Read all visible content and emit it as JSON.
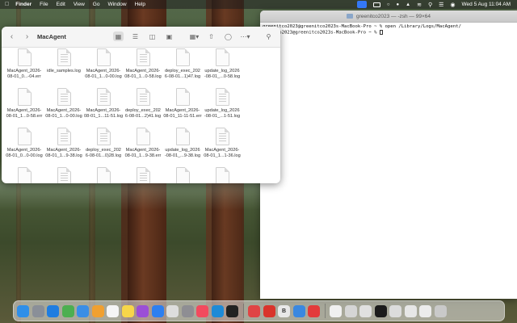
{
  "menubar": {
    "apple_icon": "",
    "app_name": "Finder",
    "menus": [
      "File",
      "Edit",
      "View",
      "Go",
      "Window",
      "Help"
    ],
    "datetime": "Wed 5 Aug  11:04 AM"
  },
  "finder": {
    "folder_title": "MacAgent",
    "back_glyph": "‹",
    "forward_glyph": "›",
    "toolbar_icons": [
      "icon-view-grid-icon",
      "list-view-icon",
      "column-view-icon",
      "gallery-view-icon",
      "group-icon",
      "share-icon",
      "tag-icon",
      "more-icon",
      "search-icon"
    ],
    "files": [
      {
        "label1": "MacAgent_2026-",
        "label2": "08-01_0...-04.err",
        "kind": "plain"
      },
      {
        "label1": "idle_samples.log",
        "label2": "",
        "kind": "log"
      },
      {
        "label1": "MacAgent_2026-",
        "label2": "08-01_1...0-00.log",
        "kind": "plain"
      },
      {
        "label1": "MacAgent_2026-",
        "label2": "08-01_1...0-58.log",
        "kind": "log"
      },
      {
        "label1": "deploy_exec_202",
        "label2": "6-08-01...1)47.log",
        "kind": "plain"
      },
      {
        "label1": "update_log_2026",
        "label2": "-08-01_...0-58.log",
        "kind": "plain"
      },
      {
        "label1": "MacAgent_2026-",
        "label2": "08-01_1...0-58.err",
        "kind": "plain"
      },
      {
        "label1": "MacAgent_2026-",
        "label2": "08-01_1...0-00.log",
        "kind": "log"
      },
      {
        "label1": "MacAgent_2026-",
        "label2": "08-01_1...11-51.log",
        "kind": "log"
      },
      {
        "label1": "deploy_exec_202",
        "label2": "6-08-01...2)41.log",
        "kind": "log"
      },
      {
        "label1": "MacAgent_2026-",
        "label2": "08-01_11-11-51.err",
        "kind": "plain"
      },
      {
        "label1": "update_log_2026",
        "label2": "-08-01_...1-51.log",
        "kind": "log"
      },
      {
        "label1": "MacAgent_2026-",
        "label2": "08-01_0...0-00.log",
        "kind": "plain"
      },
      {
        "label1": "MacAgent_2026-",
        "label2": "08-01_1...9-38.log",
        "kind": "log"
      },
      {
        "label1": "deploy_exec_202",
        "label2": "6-08-01...0)28.log",
        "kind": "log"
      },
      {
        "label1": "MacAgent_2026-",
        "label2": "08-01_1...9-38.err",
        "kind": "plain"
      },
      {
        "label1": "update_log_2026",
        "label2": "-08-01_...9-38.log",
        "kind": "plain"
      },
      {
        "label1": "MacAgent_2026-",
        "label2": "08-01_1...1-36.log",
        "kind": "log"
      },
      {
        "label1": "",
        "label2": "",
        "kind": "plain"
      },
      {
        "label1": "",
        "label2": "",
        "kind": "log"
      },
      {
        "label1": "",
        "label2": "",
        "kind": "plain"
      },
      {
        "label1": "",
        "label2": "",
        "kind": "log"
      },
      {
        "label1": "",
        "label2": "",
        "kind": "plain"
      },
      {
        "label1": "",
        "label2": "",
        "kind": "plain"
      }
    ]
  },
  "terminal": {
    "title": "greenitco2023 — -zsh — 99×64",
    "line1": "greenitco2023@greenitco2023s-MacBook-Pro ~ % open /Library/Logs/MacAgent/",
    "line2": "     co2023@greenitco2023s-MacBook-Pro ~ % "
  },
  "dock": {
    "apps": [
      {
        "name": "finder-icon",
        "color": "#2f8fe8",
        "glyph": ""
      },
      {
        "name": "launchpad-icon",
        "color": "#8a8f98",
        "glyph": ""
      },
      {
        "name": "safari-icon",
        "color": "#1f7de0",
        "glyph": ""
      },
      {
        "name": "maps-icon",
        "color": "#4caf50",
        "glyph": ""
      },
      {
        "name": "mail-icon",
        "color": "#3a8ee6",
        "glyph": ""
      },
      {
        "name": "photos-icon",
        "color": "#f0a030",
        "glyph": ""
      },
      {
        "name": "calendar-icon",
        "color": "#f5f5f5",
        "glyph": ""
      },
      {
        "name": "notes-icon",
        "color": "#f7d64a",
        "glyph": ""
      },
      {
        "name": "podcasts-icon",
        "color": "#9b4fd6",
        "glyph": ""
      },
      {
        "name": "appstore-icon",
        "color": "#2d7ff0",
        "glyph": ""
      },
      {
        "name": "pencil-app-icon",
        "color": "#dddddd",
        "glyph": ""
      },
      {
        "name": "system-settings-icon",
        "color": "#8e8e93",
        "glyph": ""
      },
      {
        "name": "music-icon",
        "color": "#f24a5e",
        "glyph": ""
      },
      {
        "name": "vscode-icon",
        "color": "#1f8ad6",
        "glyph": ""
      },
      {
        "name": "terminal-icon",
        "color": "#222222",
        "glyph": ""
      },
      {
        "name": "sep",
        "color": "",
        "glyph": ""
      },
      {
        "name": "cursor-app-icon",
        "color": "#e04545",
        "glyph": ""
      },
      {
        "name": "design-app-icon",
        "color": "#d9342b",
        "glyph": ""
      },
      {
        "name": "bbedit-icon",
        "color": "#e8e8e8",
        "glyph": "B"
      },
      {
        "name": "chrome-icon",
        "color": "#3a88e0",
        "glyph": ""
      },
      {
        "name": "speedtest-icon",
        "color": "#e33b3b",
        "glyph": ""
      },
      {
        "name": "sep",
        "color": "",
        "glyph": ""
      },
      {
        "name": "preview-icon",
        "color": "#f0f0f0",
        "glyph": ""
      },
      {
        "name": "window-thumb-1-icon",
        "color": "#d5d5d5",
        "glyph": ""
      },
      {
        "name": "window-thumb-2-icon",
        "color": "#e0e0e0",
        "glyph": ""
      },
      {
        "name": "window-thumb-3-icon",
        "color": "#1c1c1c",
        "glyph": ""
      },
      {
        "name": "window-thumb-4-icon",
        "color": "#dcdcdc",
        "glyph": ""
      },
      {
        "name": "window-thumb-5-icon",
        "color": "#e6e6e6",
        "glyph": ""
      },
      {
        "name": "window-thumb-6-icon",
        "color": "#ececec",
        "glyph": ""
      },
      {
        "name": "trash-icon",
        "color": "#c9c9c9",
        "glyph": ""
      }
    ]
  }
}
